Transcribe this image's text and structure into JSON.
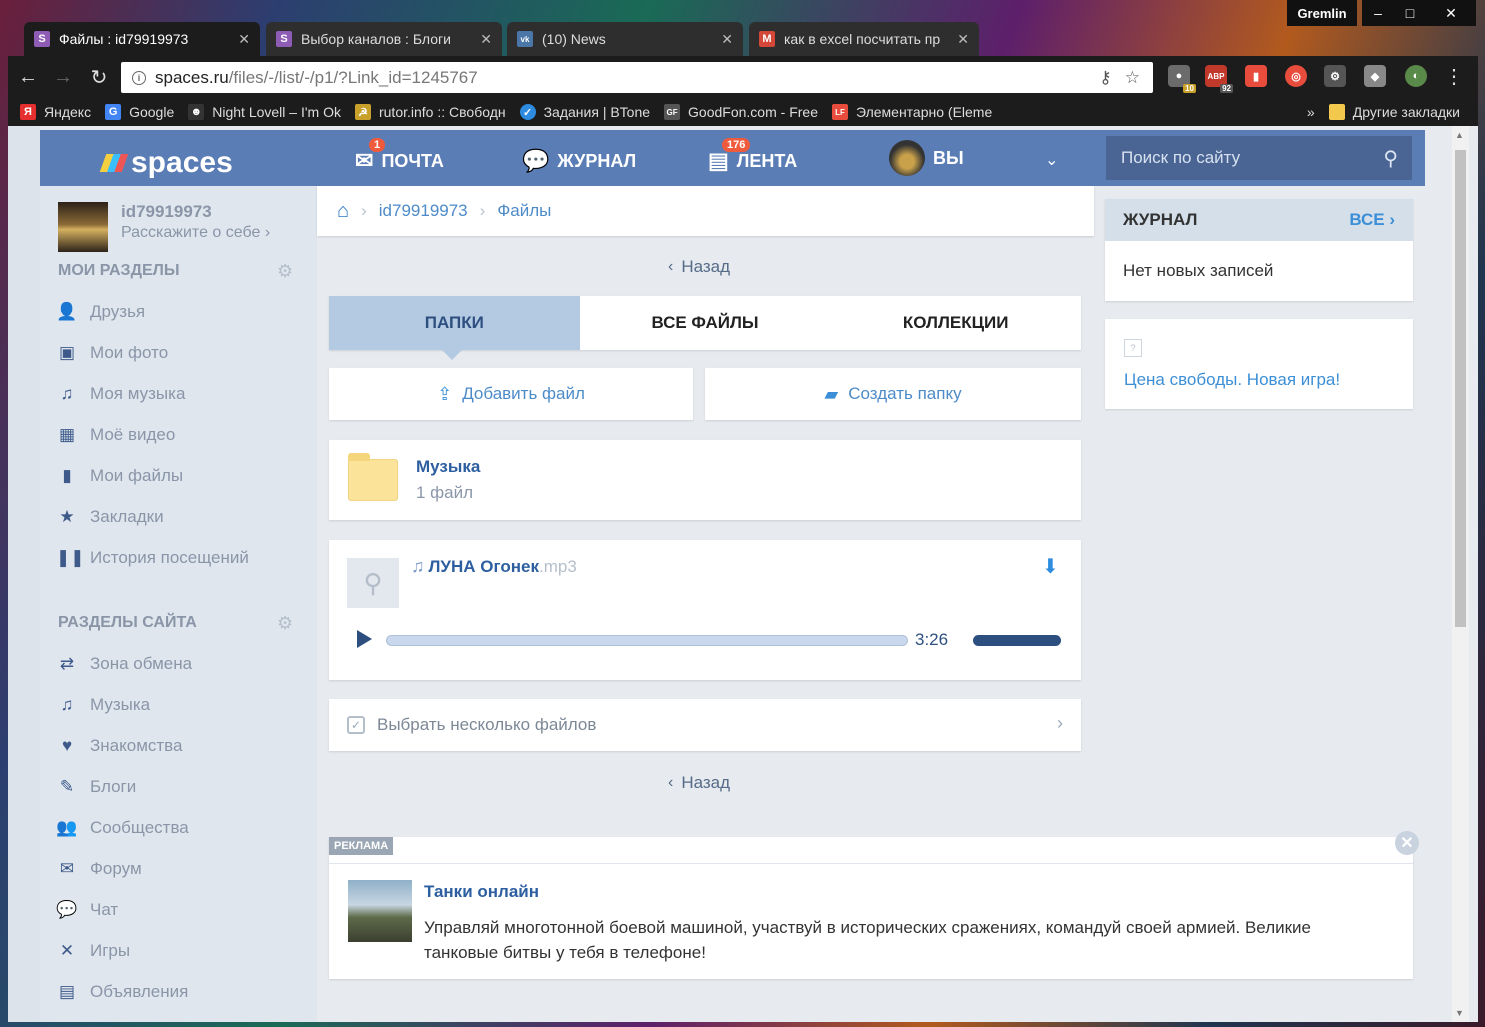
{
  "window": {
    "profile_name": "Gremlin",
    "min": "–",
    "max": "□",
    "close": "✕"
  },
  "tabs": [
    {
      "title": "Файлы : id79919973",
      "icon": "S",
      "icon_color": "#8e5bb5"
    },
    {
      "title": "Выбор каналов : Блоги",
      "icon": "S",
      "icon_color": "#8e5bb5"
    },
    {
      "title": "(10) News",
      "icon": "vk",
      "icon_color": "#4a76a8"
    },
    {
      "title": "как в excel посчитать пр",
      "icon": "M",
      "icon_color": "#d44638"
    }
  ],
  "toolbar": {
    "url_host": "spaces.ru",
    "url_path": "/files/-/list/-/p1/?Link_id=1245767",
    "ext_badge_1": "10",
    "ext_badge_2": "92",
    "ext_abp_label": "ABP"
  },
  "bookmarks": [
    {
      "label": "Яндекс",
      "icon": "Я",
      "icon_color": "#e62e2e"
    },
    {
      "label": "Google",
      "icon": "G",
      "icon_color": "#4285f4"
    },
    {
      "label": "Night Lovell – I'm Ok",
      "icon": "☻",
      "icon_color": "#333"
    },
    {
      "label": "rutor.info :: Свободн",
      "icon": "☭",
      "icon_color": "#c8a02a"
    },
    {
      "label": "Задания | BTone",
      "icon": "✓",
      "icon_color": "#2d8ce0"
    },
    {
      "label": "GoodFon.com - Free",
      "icon": "GF",
      "icon_color": "#555"
    },
    {
      "label": "Элементарно (Eleme",
      "icon": "LF",
      "icon_color": "#e74c3c"
    }
  ],
  "bookmarks_more": "»",
  "bookmarks_other": "Другие закладки",
  "site": {
    "logo": "spaces",
    "nav": {
      "mail_label": "ПОЧТА",
      "mail_badge": "1",
      "journal_label": "ЖУРНАЛ",
      "feed_label": "ЛЕНТА",
      "feed_badge": "176",
      "you_label": "ВЫ"
    },
    "search_placeholder": "Поиск по сайту"
  },
  "sidebar": {
    "user_id": "id79919973",
    "about": "Расскажите о себе ›",
    "my_sections_title": "МОИ РАЗДЕЛЫ",
    "my_sections": [
      {
        "label": "Друзья",
        "icon": "👤"
      },
      {
        "label": "Мои фото",
        "icon": "▣"
      },
      {
        "label": "Моя музыка",
        "icon": "♫"
      },
      {
        "label": "Моё видео",
        "icon": "▦"
      },
      {
        "label": "Мои файлы",
        "icon": "▮"
      },
      {
        "label": "Закладки",
        "icon": "★"
      },
      {
        "label": "История посещений",
        "icon": "❚❚"
      }
    ],
    "site_sections_title": "РАЗДЕЛЫ САЙТА",
    "site_sections": [
      {
        "label": "Зона обмена",
        "icon": "⇄"
      },
      {
        "label": "Музыка",
        "icon": "♫"
      },
      {
        "label": "Знакомства",
        "icon": "♥"
      },
      {
        "label": "Блоги",
        "icon": "✎"
      },
      {
        "label": "Сообщества",
        "icon": "👥"
      },
      {
        "label": "Форум",
        "icon": "✉"
      },
      {
        "label": "Чат",
        "icon": "💬"
      },
      {
        "label": "Игры",
        "icon": "✕"
      },
      {
        "label": "Объявления",
        "icon": "▤"
      }
    ]
  },
  "main": {
    "breadcrumb": {
      "user": "id79919973",
      "files": "Файлы"
    },
    "back_label": "Назад",
    "file_tabs": [
      "ПАПКИ",
      "ВСЕ ФАЙЛЫ",
      "КОЛЛЕКЦИИ"
    ],
    "add_file": "Добавить файл",
    "create_folder": "Создать папку",
    "folder": {
      "name": "Музыка",
      "count": "1 файл"
    },
    "file": {
      "name": "ЛУНА Огонек",
      "ext": ".mp3",
      "duration": "3:26",
      "progress": 0.0,
      "volume": 1.0
    },
    "select_multiple": "Выбрать несколько файлов"
  },
  "ad": {
    "label": "РЕКЛАМА",
    "title": "Танки онлайн",
    "text": "Управляй многотонной боевой машиной, участвуй в исторических сражениях, командуй своей армией. Великие танковые битвы у тебя в телефоне!"
  },
  "right": {
    "journal_title": "ЖУРНАЛ",
    "journal_all": "ВСЕ ›",
    "journal_empty": "Нет новых записей",
    "promo_link": "Цена свободы. Новая игра!"
  }
}
